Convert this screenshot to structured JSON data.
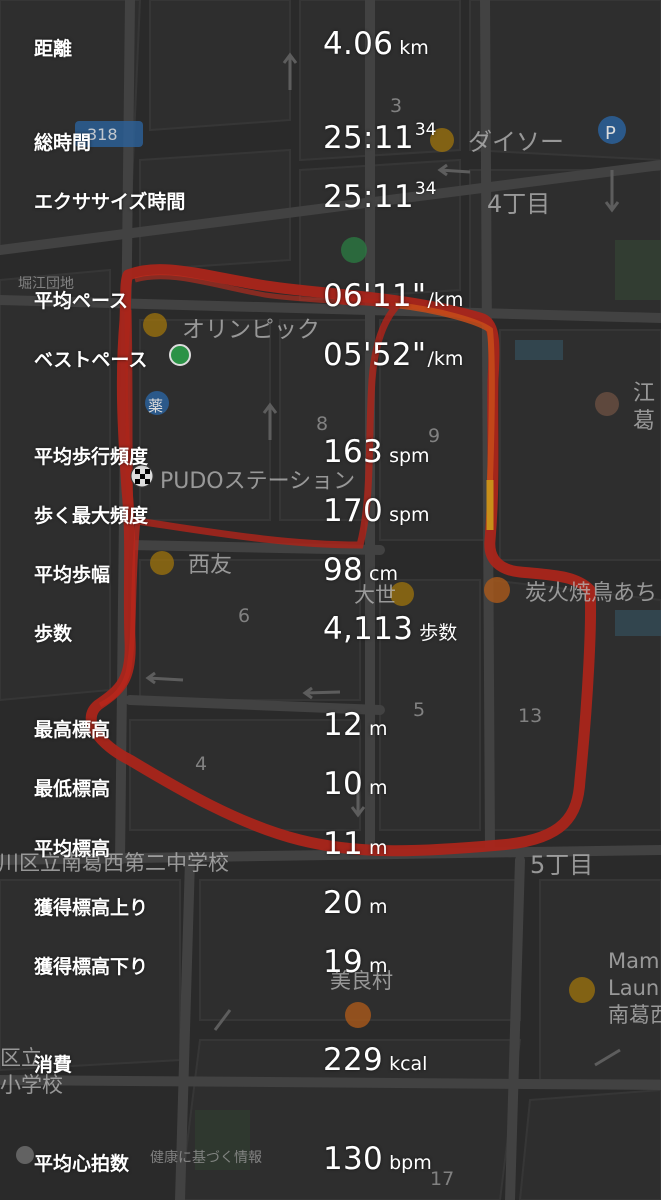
{
  "map": {
    "labels": {
      "daiso": "ダイソー",
      "olympic": "オリンピック",
      "pudo": "PUDOステーション",
      "nishitomo": "西友",
      "daisei": "大世",
      "sumibi": "炭火焼鳥あち",
      "kyoei": "江",
      "katsu": "葛",
      "chome4": "4丁目",
      "chome5": "5丁目",
      "school": "川区立南葛西第二中学校",
      "ward": "区立",
      "elementary": "小学校",
      "bimura": "美良村",
      "mam": "Mam",
      "laun": "Laun",
      "minamikasai": "南葛西",
      "route": "318",
      "horie": "堀江団地",
      "parking": "P",
      "block3": "3",
      "block4": "4",
      "block5": "5",
      "block6": "6",
      "block8": "8",
      "block9": "9",
      "block13": "13",
      "block17": "17",
      "health": "健康に基づく情報",
      "medicine": "薬"
    }
  },
  "stats": [
    {
      "label": "距離",
      "value": "4.06",
      "unit": "km"
    },
    {
      "label": "総時間",
      "value": "25:11",
      "sup": "34"
    },
    {
      "label": "エクササイズ時間",
      "value": "25:11",
      "sup": "34"
    },
    {
      "label": "平均ペース",
      "value": "06'11\"",
      "unit": "/km"
    },
    {
      "label": "ベストペース",
      "value": "05'52\"",
      "unit": "/km"
    },
    {
      "label": "平均歩行頻度",
      "value": "163",
      "unit": "spm"
    },
    {
      "label": "歩く最大頻度",
      "value": "170",
      "unit": "spm"
    },
    {
      "label": "平均歩幅",
      "value": "98",
      "unit": "cm"
    },
    {
      "label": "歩数",
      "value": "4,113",
      "unit": "歩数"
    },
    {
      "label": "最高標高",
      "value": "12",
      "unit": "m"
    },
    {
      "label": "最低標高",
      "value": "10",
      "unit": "m"
    },
    {
      "label": "平均標高",
      "value": "11",
      "unit": "m"
    },
    {
      "label": "獲得標高上り",
      "value": "20",
      "unit": "m"
    },
    {
      "label": "獲得標高下り",
      "value": "19",
      "unit": "m"
    },
    {
      "label": "消費",
      "value": "229",
      "unit": "kcal"
    },
    {
      "label": "平均心拍数",
      "value": "130",
      "unit": "bpm"
    }
  ],
  "colors": {
    "route": "#d42a1e",
    "route_highlight": "#e8a51a",
    "map_bg": "#2f2f2f",
    "text": "#ffffff"
  }
}
